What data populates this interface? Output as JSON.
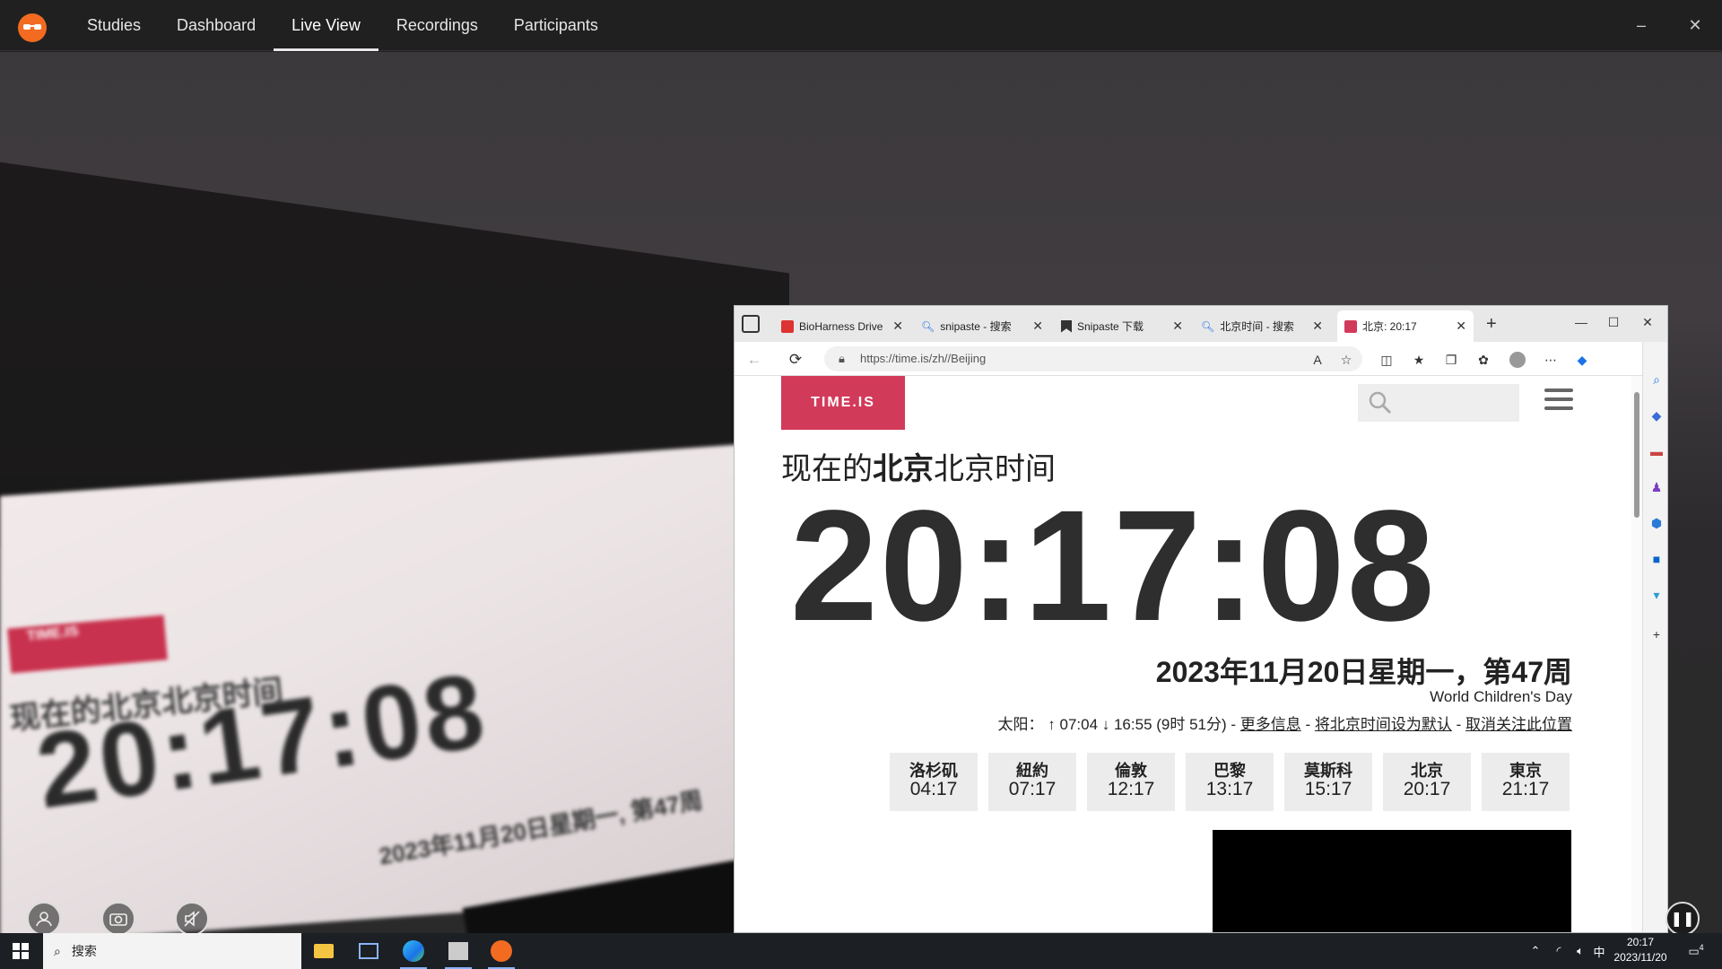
{
  "app": {
    "nav": [
      "Studies",
      "Dashboard",
      "Live View",
      "Recordings",
      "Participants"
    ],
    "active_tab": "Live View",
    "minimize_glyph": "–",
    "close_glyph": "✕"
  },
  "live_view": {
    "photo_badge": "TIME.IS",
    "photo_heading": "现在的北京北京时间",
    "photo_clock": "20:17:08",
    "photo_date": "2023年11月20日星期一, 第47周"
  },
  "browser": {
    "tabs": [
      {
        "title": "BioHarness Drive",
        "icon": "pdf-icon"
      },
      {
        "title": "snipaste - 搜索",
        "icon": "search-icon"
      },
      {
        "title": "Snipaste 下载",
        "icon": "bookmark-icon"
      },
      {
        "title": "北京时间 - 搜索",
        "icon": "search-icon"
      },
      {
        "title": "北京: 20:17",
        "icon": "timeis-icon"
      }
    ],
    "url": "https://time.is/zh//Beijing"
  },
  "page": {
    "brand": "TIME.IS",
    "heading_pre": "现在的",
    "heading_bold": "北京",
    "heading_post": "北京时间",
    "clock": "20:17:08",
    "date": "2023年11月20日星期一，第47周",
    "holiday": "World Children's Day",
    "sun_prefix": "太阳：",
    "sun_times": "↑ 07:04 ↓ 16:55 (9时 51分) -",
    "link_more": "更多信息",
    "link_default": "将北京时间设为默认",
    "link_unfollow": "取消关注此位置",
    "sep": " - ",
    "cities": [
      {
        "name": "洛杉矶",
        "time": "04:17"
      },
      {
        "name": "紐約",
        "time": "07:17"
      },
      {
        "name": "倫敦",
        "time": "12:17"
      },
      {
        "name": "巴黎",
        "time": "13:17"
      },
      {
        "name": "莫斯科",
        "time": "15:17"
      },
      {
        "name": "北京",
        "time": "20:17"
      },
      {
        "name": "東京",
        "time": "21:17"
      }
    ]
  },
  "taskbar": {
    "search_placeholder": "搜索",
    "ime": "中",
    "time": "20:17",
    "date": "2023/11/20",
    "notification_count": "4"
  },
  "colors": {
    "accent": "#d23a5a",
    "app_logo": "#f26b21",
    "app_bar": "#202020"
  }
}
